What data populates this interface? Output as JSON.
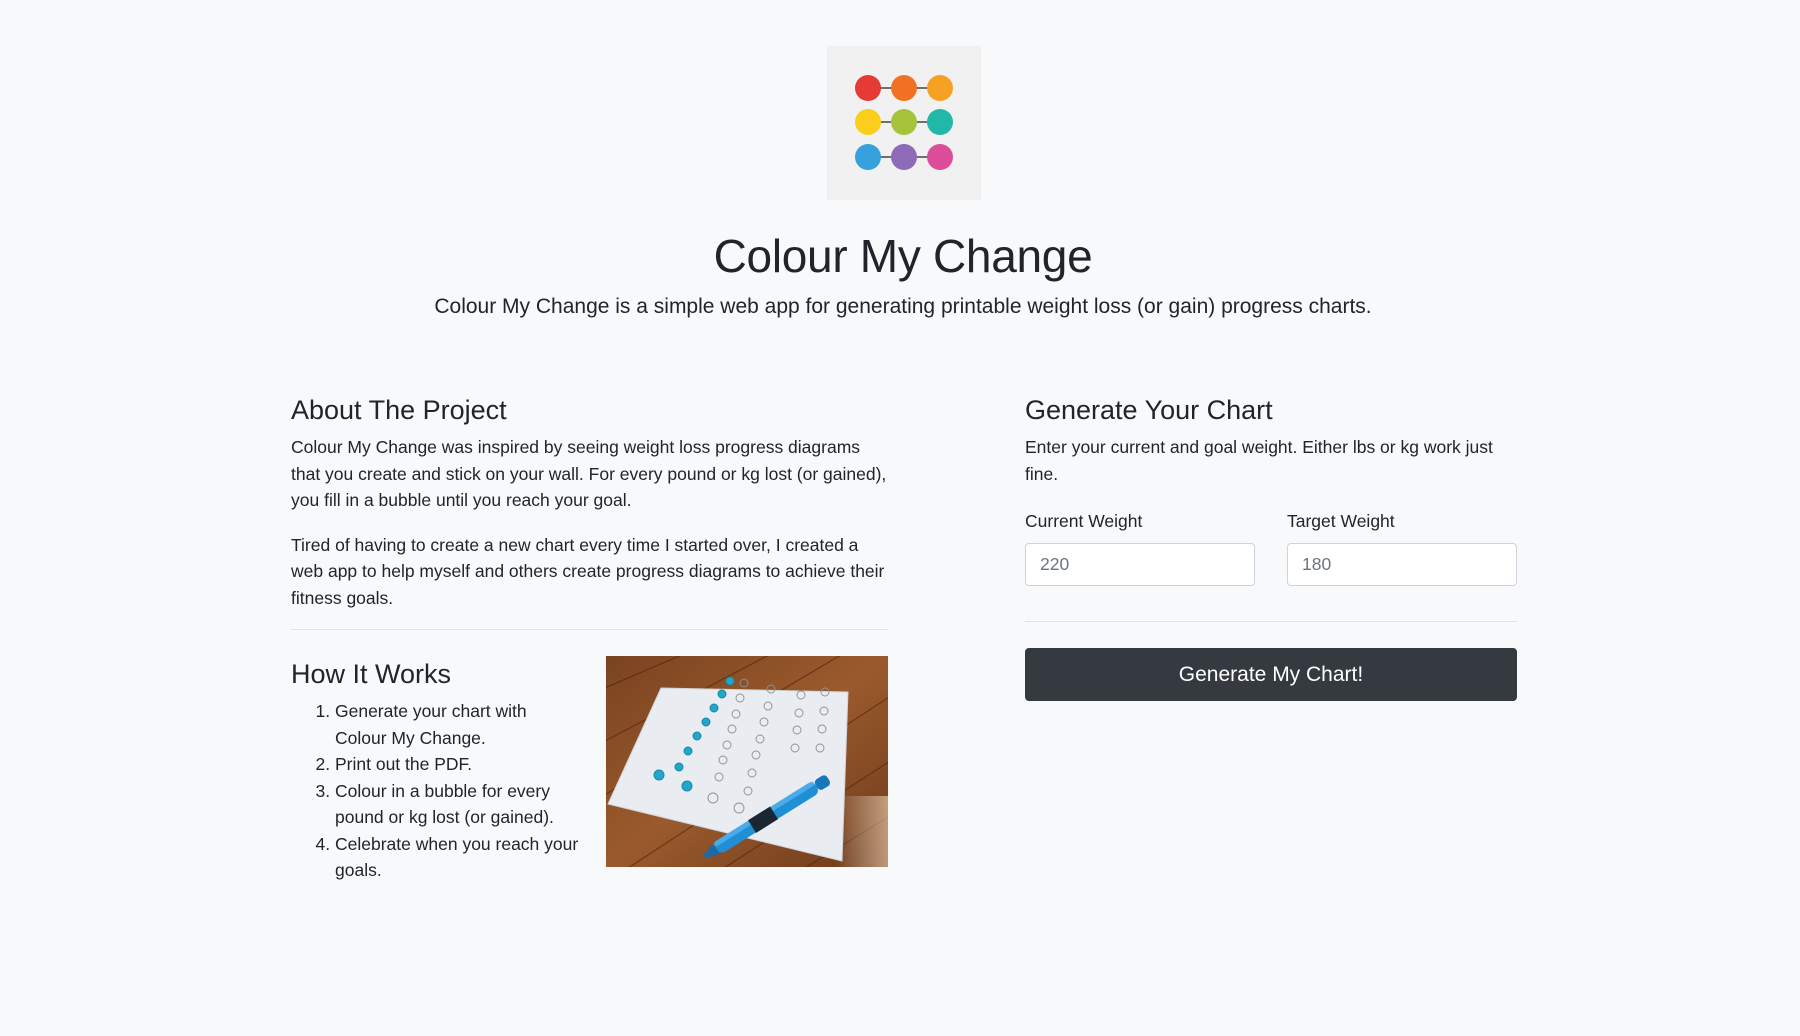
{
  "header": {
    "logo_icon": "colored-dots-grid-icon",
    "logo_colors": [
      "#e53a35",
      "#f07124",
      "#f7a124",
      "#fbce1c",
      "#a6c23a",
      "#22b8a8",
      "#36a1dc",
      "#8e6bb6",
      "#dc4c98"
    ],
    "title": "Colour My Change",
    "lead": "Colour My Change is a simple web app for generating printable weight loss (or gain) progress charts."
  },
  "about": {
    "heading": "About The Project",
    "paragraphs": [
      "Colour My Change was inspired by seeing weight loss progress diagrams that you create and stick on your wall. For every pound or kg lost (or gained), you fill in a bubble until you reach your goal.",
      "Tired of having to create a new chart every time I started over, I created a web app to help myself and others create progress diagrams to achieve their fitness goals."
    ]
  },
  "how_it_works": {
    "heading": "How It Works",
    "steps": [
      "Generate your chart with Colour My Change.",
      "Print out the PDF.",
      "Colour in a bubble for every pound or kg lost (or gained).",
      "Celebrate when you reach your goals."
    ]
  },
  "generator": {
    "heading": "Generate Your Chart",
    "description": "Enter your current and goal weight. Either lbs or kg work just fine.",
    "current_weight": {
      "label": "Current Weight",
      "placeholder": "220",
      "value": ""
    },
    "target_weight": {
      "label": "Target Weight",
      "placeholder": "180",
      "value": ""
    },
    "button_label": "Generate My Chart!"
  },
  "colors": {
    "background": "#f8f9fa",
    "button": "#343a40",
    "text": "#212529",
    "marker": "#1f8fd6",
    "filled_bubble": "#22a6c9",
    "wood": "#8a4f26"
  }
}
